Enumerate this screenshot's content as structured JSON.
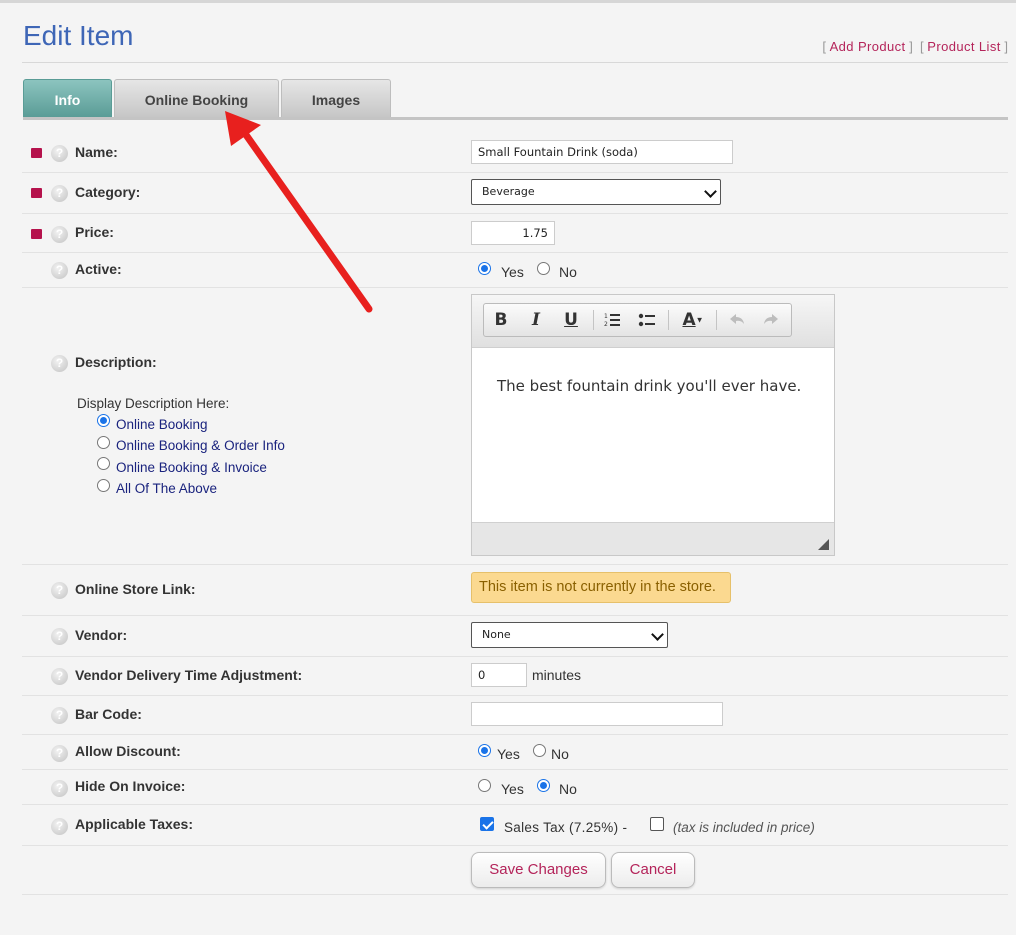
{
  "header": {
    "title": "Edit Item",
    "add_product": "Add Product",
    "product_list": "Product List",
    "bracket_open": "[",
    "bracket_close": "]"
  },
  "tabs": [
    {
      "label": "Info",
      "active": true
    },
    {
      "label": "Online Booking",
      "active": false
    },
    {
      "label": "Images",
      "active": false
    }
  ],
  "help_glyph": "?",
  "fields": {
    "name": {
      "label": "Name:",
      "value": "Small Fountain Drink (soda)",
      "required": true
    },
    "category": {
      "label": "Category:",
      "value": "Beverage",
      "required": true
    },
    "price": {
      "label": "Price:",
      "value": "1.75",
      "required": true
    },
    "active": {
      "label": "Active:",
      "options": [
        "Yes",
        "No"
      ],
      "selected": "Yes"
    },
    "description": {
      "label": "Description:",
      "content": "The best fountain drink you'll ever have.",
      "display_label": "Display Description Here:",
      "display_options": [
        "Online Booking",
        "Online Booking & Order Info",
        "Online Booking & Invoice",
        "All Of The Above"
      ],
      "display_selected": "Online Booking",
      "toolbar": {
        "bold": "B",
        "italic": "I",
        "underline": "U",
        "font_color": "A"
      }
    },
    "online_store_link": {
      "label": "Online Store Link:",
      "notice": "This item is not currently in the store."
    },
    "vendor": {
      "label": "Vendor:",
      "value": "None"
    },
    "vendor_delivery": {
      "label": "Vendor Delivery Time Adjustment:",
      "value": "0",
      "unit": "minutes"
    },
    "bar_code": {
      "label": "Bar Code:",
      "value": ""
    },
    "allow_discount": {
      "label": "Allow Discount:",
      "options": [
        "Yes",
        "No"
      ],
      "selected": "Yes"
    },
    "hide_on_invoice": {
      "label": "Hide On Invoice:",
      "options": [
        "Yes",
        "No"
      ],
      "selected": "No"
    },
    "applicable_taxes": {
      "label": "Applicable Taxes:",
      "tax_name": "Sales Tax (7.25%) -",
      "tax_checked": true,
      "included_note": "(tax is included in price)",
      "included_checked": false
    }
  },
  "buttons": {
    "save": "Save Changes",
    "cancel": "Cancel"
  },
  "colors": {
    "accent": "#3e66b6",
    "required": "#b5124c",
    "link": "#b4245a",
    "arrow": "#e8201e",
    "active_tab": "#5a9c96"
  }
}
